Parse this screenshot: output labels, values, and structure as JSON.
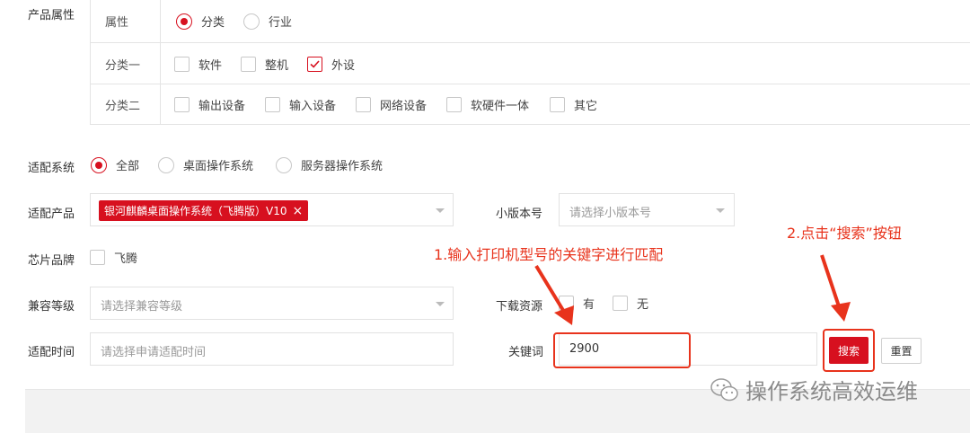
{
  "product_attr": {
    "label": "产品属性",
    "rows": {
      "attr": {
        "label": "属性",
        "options": [
          "分类",
          "行业"
        ],
        "selected": "分类"
      },
      "cat1": {
        "label": "分类一",
        "options": [
          "软件",
          "整机",
          "外设"
        ],
        "checked": [
          "外设"
        ]
      },
      "cat2": {
        "label": "分类二",
        "options": [
          "输出设备",
          "输入设备",
          "网络设备",
          "软硬件一体",
          "其它"
        ],
        "checked": []
      }
    }
  },
  "adapt_system": {
    "label": "适配系统",
    "options": [
      "全部",
      "桌面操作系统",
      "服务器操作系统"
    ],
    "selected": "全部"
  },
  "adapt_product": {
    "label": "适配产品",
    "tag": "银河麒麟桌面操作系统（飞腾版）V10",
    "tag_close": "×"
  },
  "minor_version": {
    "label": "小版本号",
    "placeholder": "请选择小版本号"
  },
  "chip_brand": {
    "label": "芯片品牌",
    "options": [
      "飞腾"
    ]
  },
  "compat_level": {
    "label": "兼容等级",
    "placeholder": "请选择兼容等级"
  },
  "download": {
    "label": "下载资源",
    "options": [
      "有",
      "无"
    ]
  },
  "adapt_time": {
    "label": "适配时间",
    "placeholder": "请选择申请适配时间"
  },
  "keyword": {
    "label": "关键词",
    "value": "2900"
  },
  "buttons": {
    "search": "搜索",
    "reset": "重置"
  },
  "annotations": {
    "step1": "1.输入打印机型号的关键字进行匹配",
    "step2": "2.点击“搜索”按钮"
  },
  "watermark": "操作系统高效运维",
  "colors": {
    "accent": "#d7101f",
    "annotation": "#e8331c"
  }
}
